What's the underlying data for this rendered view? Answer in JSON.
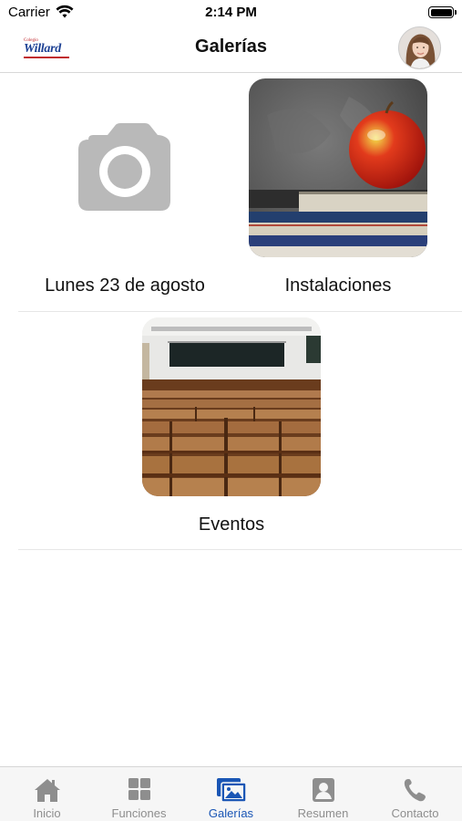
{
  "status_bar": {
    "carrier": "Carrier",
    "time": "2:14 PM"
  },
  "nav": {
    "title": "Galerías",
    "logo_small": "Colegio",
    "logo_main": "Willard"
  },
  "galleries": [
    {
      "label": "Lunes 23 de agosto",
      "image": "camera-placeholder"
    },
    {
      "label": "Instalaciones",
      "image": "apple-on-books-photo"
    },
    {
      "label": "Eventos",
      "image": "auditorium-seats-photo"
    }
  ],
  "tabs": [
    {
      "label": "Inicio",
      "icon": "home-icon",
      "active": false
    },
    {
      "label": "Funciones",
      "icon": "grid-icon",
      "active": false
    },
    {
      "label": "Galerías",
      "icon": "gallery-icon",
      "active": true
    },
    {
      "label": "Resumen",
      "icon": "person-card-icon",
      "active": false
    },
    {
      "label": "Contacto",
      "icon": "phone-icon",
      "active": false
    }
  ],
  "colors": {
    "accent": "#1a56b5",
    "inactive": "#8e8e8e",
    "placeholder_gray": "#b7b7b7"
  }
}
